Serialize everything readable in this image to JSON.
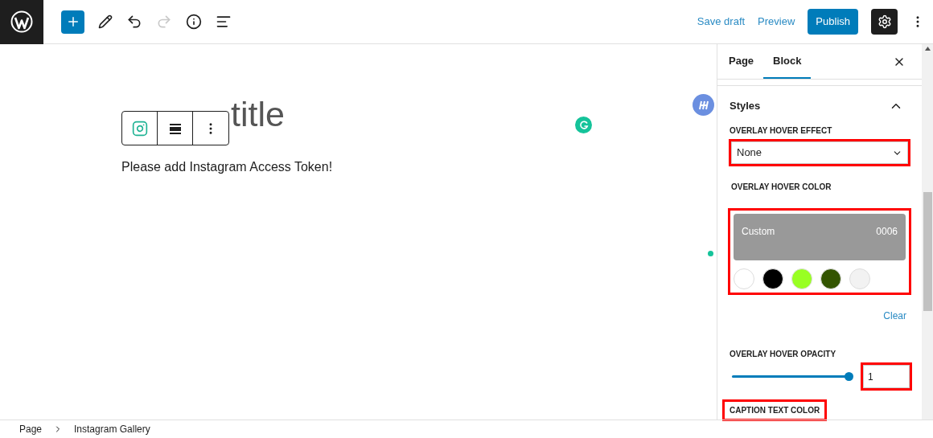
{
  "header": {
    "actions": [
      {
        "label": "Save draft",
        "kind": "link"
      },
      {
        "label": "Preview",
        "kind": "link"
      },
      {
        "label": "Publish",
        "kind": "primary"
      }
    ],
    "toolbar": [
      {
        "kind": "add",
        "active": true
      },
      {
        "kind": "edit",
        "active": true
      },
      {
        "kind": "undo",
        "active": true
      },
      {
        "kind": "redo",
        "active": false
      },
      {
        "kind": "info",
        "active": true
      },
      {
        "kind": "outline",
        "active": true
      }
    ],
    "settings_pressed": true
  },
  "editor": {
    "title_placeholder": "title",
    "block_toolbar": [
      {
        "kind": "instagram"
      },
      {
        "kind": "align"
      },
      {
        "kind": "more"
      }
    ],
    "message": "Please add Instagram Access Token!"
  },
  "sidebar": {
    "tabs": [
      {
        "label": "Page",
        "selected": false
      },
      {
        "label": "Block",
        "selected": true
      }
    ],
    "panel": {
      "title": "Styles",
      "expanded": true,
      "hover_effect": {
        "label": "OVERLAY HOVER EFFECT",
        "value": "None",
        "highlighted": true
      },
      "hover_color": {
        "label": "OVERLAY HOVER COLOR",
        "name": "Custom",
        "code": "0006",
        "highlighted": true,
        "swatches": [
          {
            "color": "#ffffff"
          },
          {
            "color": "#000000"
          },
          {
            "color": "#99ff22"
          },
          {
            "color": "#335500"
          },
          {
            "color": "#f2f2f2"
          }
        ],
        "clear": "Clear"
      },
      "hover_opacity": {
        "label": "OVERLAY HOVER OPACITY",
        "level": 1,
        "value": "1",
        "highlighted": true
      },
      "caption_color": {
        "label": "CAPTION TEXT COLOR",
        "highlighted": true
      }
    }
  },
  "breadcrumb": [
    "Page",
    "Instagram Gallery"
  ]
}
